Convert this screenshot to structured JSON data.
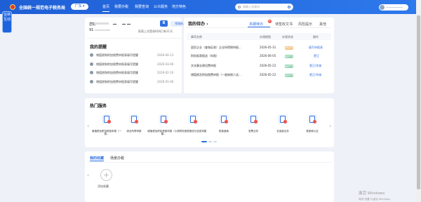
{
  "header": {
    "title": "全国统一规范电子税务局",
    "region_label": "广东",
    "nav": [
      "首页",
      "我要办税",
      "我要查询",
      "公众服务",
      "地方特色"
    ],
    "search_placeholder": "请输入关键词"
  },
  "float_tab": {
    "line1": "征纳",
    "line2": "互动"
  },
  "user_card": {
    "greeting": "您好",
    "uid_prefix": "91",
    "cert_icon": "B",
    "cert_button": "领域纳入",
    "login_info": "距离上次登录时间已有11天"
  },
  "reminders": {
    "title": "我的提醒",
    "items": [
      {
        "text": "增值税和附加税费申报表填写提醒",
        "date": "2026-04-13"
      },
      {
        "text": "增值税和附加税费申报表填写提醒",
        "date": "2026-03-06"
      },
      {
        "text": "增值税和附加税费申报表填写提醒",
        "date": "2026-02-10"
      },
      {
        "text": "增值税和附加税费申报表填写提醒",
        "date": "2026-01-06"
      }
    ]
  },
  "todo": {
    "title": "我的待办",
    "tabs": [
      "本期待办",
      "待签收文书",
      "风险提示",
      "其他"
    ],
    "badge": "8",
    "columns": [
      "事项名称",
      "办理期限",
      "办理状态",
      "操作"
    ],
    "rows": [
      {
        "name": "居民企业（查账征收）企业所得税申报...",
        "deadline": "2026-05-31",
        "status": "未申报",
        "status_type": "warn",
        "action": "填写申报表"
      },
      {
        "name": "财务报表报送（年报）",
        "deadline": "2026-06-05",
        "status": "已申报",
        "status_type": "ok",
        "action": "更正"
      },
      {
        "name": "文化事业建设费申报",
        "deadline": "2026-05-22",
        "status": "已申报",
        "status_type": "ok",
        "action": "更正/作废"
      },
      {
        "name": "增值税及附加税费申报（一般纳税人适...",
        "deadline": "2026-05-22",
        "status": "已申报",
        "status_type": "ok",
        "action": "更正/作废"
      }
    ]
  },
  "services": {
    "title": "热门服务",
    "items": [
      "增值税及附加税费申报（一般...",
      "综合所得申报",
      "增值税及附加税费申报（小规模...",
      "财务报表报送与信息采集",
      "税费缴纳",
      "发票业务",
      "社保费业务",
      "税费种认定"
    ]
  },
  "favorites": {
    "tabs": [
      "我的收藏",
      "场景办税"
    ],
    "add_label": "添加收藏"
  },
  "watermark": {
    "line1": "激活 Windows",
    "line2": "转到\"设置\"以激活 Windows。"
  }
}
